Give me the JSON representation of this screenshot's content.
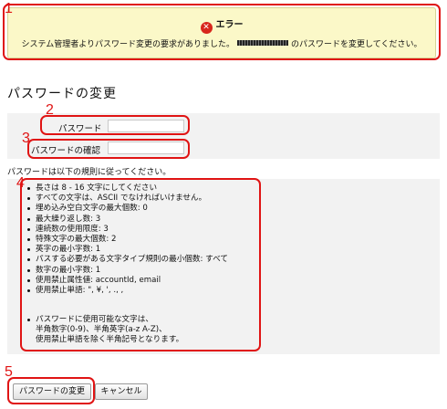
{
  "error": {
    "title": "エラー",
    "icon": "error-x-icon",
    "message_before": "システム管理者よりパスワード変更の要求がありました。",
    "message_after": "のパスワードを変更してください。"
  },
  "page": {
    "title": "パスワードの変更"
  },
  "form": {
    "password_label": "パスワード",
    "password_value": "",
    "confirm_label": "パスワードの確認",
    "confirm_value": ""
  },
  "rules": {
    "intro": "パスワードは以下の規則に従ってください。",
    "items": [
      "長さは 8 - 16 文字にしてください",
      "すべての文字は、ASCII でなければいけません。",
      "埋め込み空白文字の最大個数: 0",
      "最大繰り返し数: 3",
      "連続数の使用限度: 3",
      "特殊文字の最大個数: 2",
      "英字の最小字数: 1",
      "パスする必要がある文字タイプ規則の最小個数: すべて",
      "数字の最小字数: 1",
      "使用禁止属性値: accountId, email",
      "使用禁止単語: \", ¥, ', ., ,"
    ],
    "charset_lines": [
      "パスワードに使用可能な文字は、",
      "半角数字(0-9)、半角英字(a-z A-Z)、",
      "使用禁止単語を除く半角記号となります。"
    ]
  },
  "buttons": {
    "change": "パスワードの変更",
    "cancel": "キャンセル"
  },
  "annotations": [
    "1",
    "2",
    "3",
    "4",
    "5"
  ],
  "colors": {
    "annotation": "#e01414",
    "banner_bg": "#fbf8c8",
    "band_bg": "#f2f2f2",
    "error_icon": "#d8261c"
  }
}
